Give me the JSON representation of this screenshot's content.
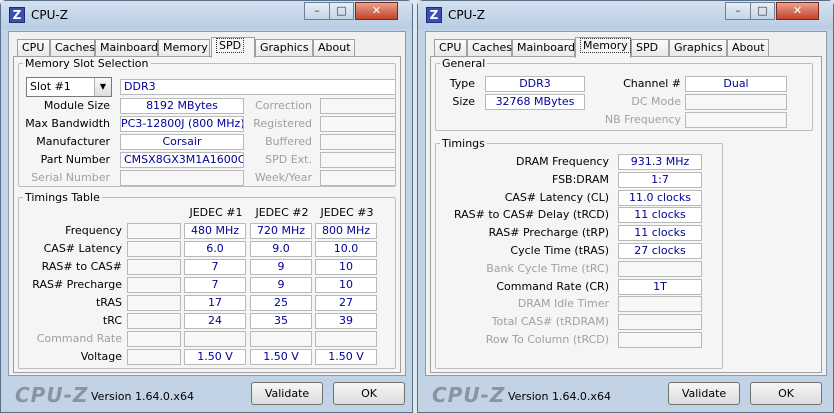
{
  "spd_window": {
    "title": "CPU-Z",
    "tabs": [
      "CPU",
      "Caches",
      "Mainboard",
      "Memory",
      "SPD",
      "Graphics",
      "About"
    ],
    "active_tab": "SPD",
    "slot_group": {
      "legend": "Memory Slot Selection",
      "slot_selected": "Slot #1",
      "type": "DDR3",
      "rows_left": [
        {
          "label": "Module Size",
          "value": "8192 MBytes"
        },
        {
          "label": "Max Bandwidth",
          "value": "PC3-12800J (800 MHz)"
        },
        {
          "label": "Manufacturer",
          "value": "Corsair"
        },
        {
          "label": "Part Number",
          "value": "CMSX8GX3M1A1600C10"
        },
        {
          "label": "Serial Number",
          "value": ""
        }
      ],
      "rows_right": [
        "Correction",
        "Registered",
        "Buffered",
        "SPD Ext.",
        "Week/Year"
      ]
    },
    "timings_group": {
      "legend": "Timings Table",
      "columns": [
        "JEDEC #1",
        "JEDEC #2",
        "JEDEC #3"
      ],
      "rows": [
        {
          "label": "Frequency",
          "values": [
            "480 MHz",
            "720 MHz",
            "800 MHz"
          ]
        },
        {
          "label": "CAS# Latency",
          "values": [
            "6.0",
            "9.0",
            "10.0"
          ]
        },
        {
          "label": "RAS# to CAS#",
          "values": [
            "7",
            "9",
            "10"
          ]
        },
        {
          "label": "RAS# Precharge",
          "values": [
            "7",
            "9",
            "10"
          ]
        },
        {
          "label": "tRAS",
          "values": [
            "17",
            "25",
            "27"
          ]
        },
        {
          "label": "tRC",
          "values": [
            "24",
            "35",
            "39"
          ]
        },
        {
          "label": "Command Rate",
          "values": [
            "",
            "",
            ""
          ]
        },
        {
          "label": "Voltage",
          "values": [
            "1.50 V",
            "1.50 V",
            "1.50 V"
          ]
        }
      ]
    },
    "footer": {
      "logo": "CPU-Z",
      "version": "Version 1.64.0.x64",
      "validate": "Validate",
      "ok": "OK"
    }
  },
  "memory_window": {
    "title": "CPU-Z",
    "tabs": [
      "CPU",
      "Caches",
      "Mainboard",
      "Memory",
      "SPD",
      "Graphics",
      "About"
    ],
    "active_tab": "Memory",
    "general": {
      "legend": "General",
      "type_label": "Type",
      "type_value": "DDR3",
      "size_label": "Size",
      "size_value": "32768 MBytes",
      "channel_label": "Channel #",
      "channel_value": "Dual",
      "dc_mode_label": "DC Mode",
      "dc_mode_value": "",
      "nb_freq_label": "NB Frequency",
      "nb_freq_value": ""
    },
    "timings": {
      "legend": "Timings",
      "rows": [
        {
          "label": "DRAM Frequency",
          "value": "931.3 MHz"
        },
        {
          "label": "FSB:DRAM",
          "value": "1:7"
        },
        {
          "label": "CAS# Latency (CL)",
          "value": "11.0 clocks"
        },
        {
          "label": "RAS# to CAS# Delay (tRCD)",
          "value": "11 clocks"
        },
        {
          "label": "RAS# Precharge (tRP)",
          "value": "11 clocks"
        },
        {
          "label": "Cycle Time (tRAS)",
          "value": "27 clocks"
        },
        {
          "label": "Bank Cycle Time (tRC)",
          "value": ""
        },
        {
          "label": "Command Rate (CR)",
          "value": "1T"
        },
        {
          "label": "DRAM Idle Timer",
          "value": ""
        },
        {
          "label": "Total CAS# (tRDRAM)",
          "value": ""
        },
        {
          "label": "Row To Column (tRCD)",
          "value": ""
        }
      ]
    },
    "footer": {
      "logo": "CPU-Z",
      "version": "Version 1.64.0.x64",
      "validate": "Validate",
      "ok": "OK"
    }
  }
}
